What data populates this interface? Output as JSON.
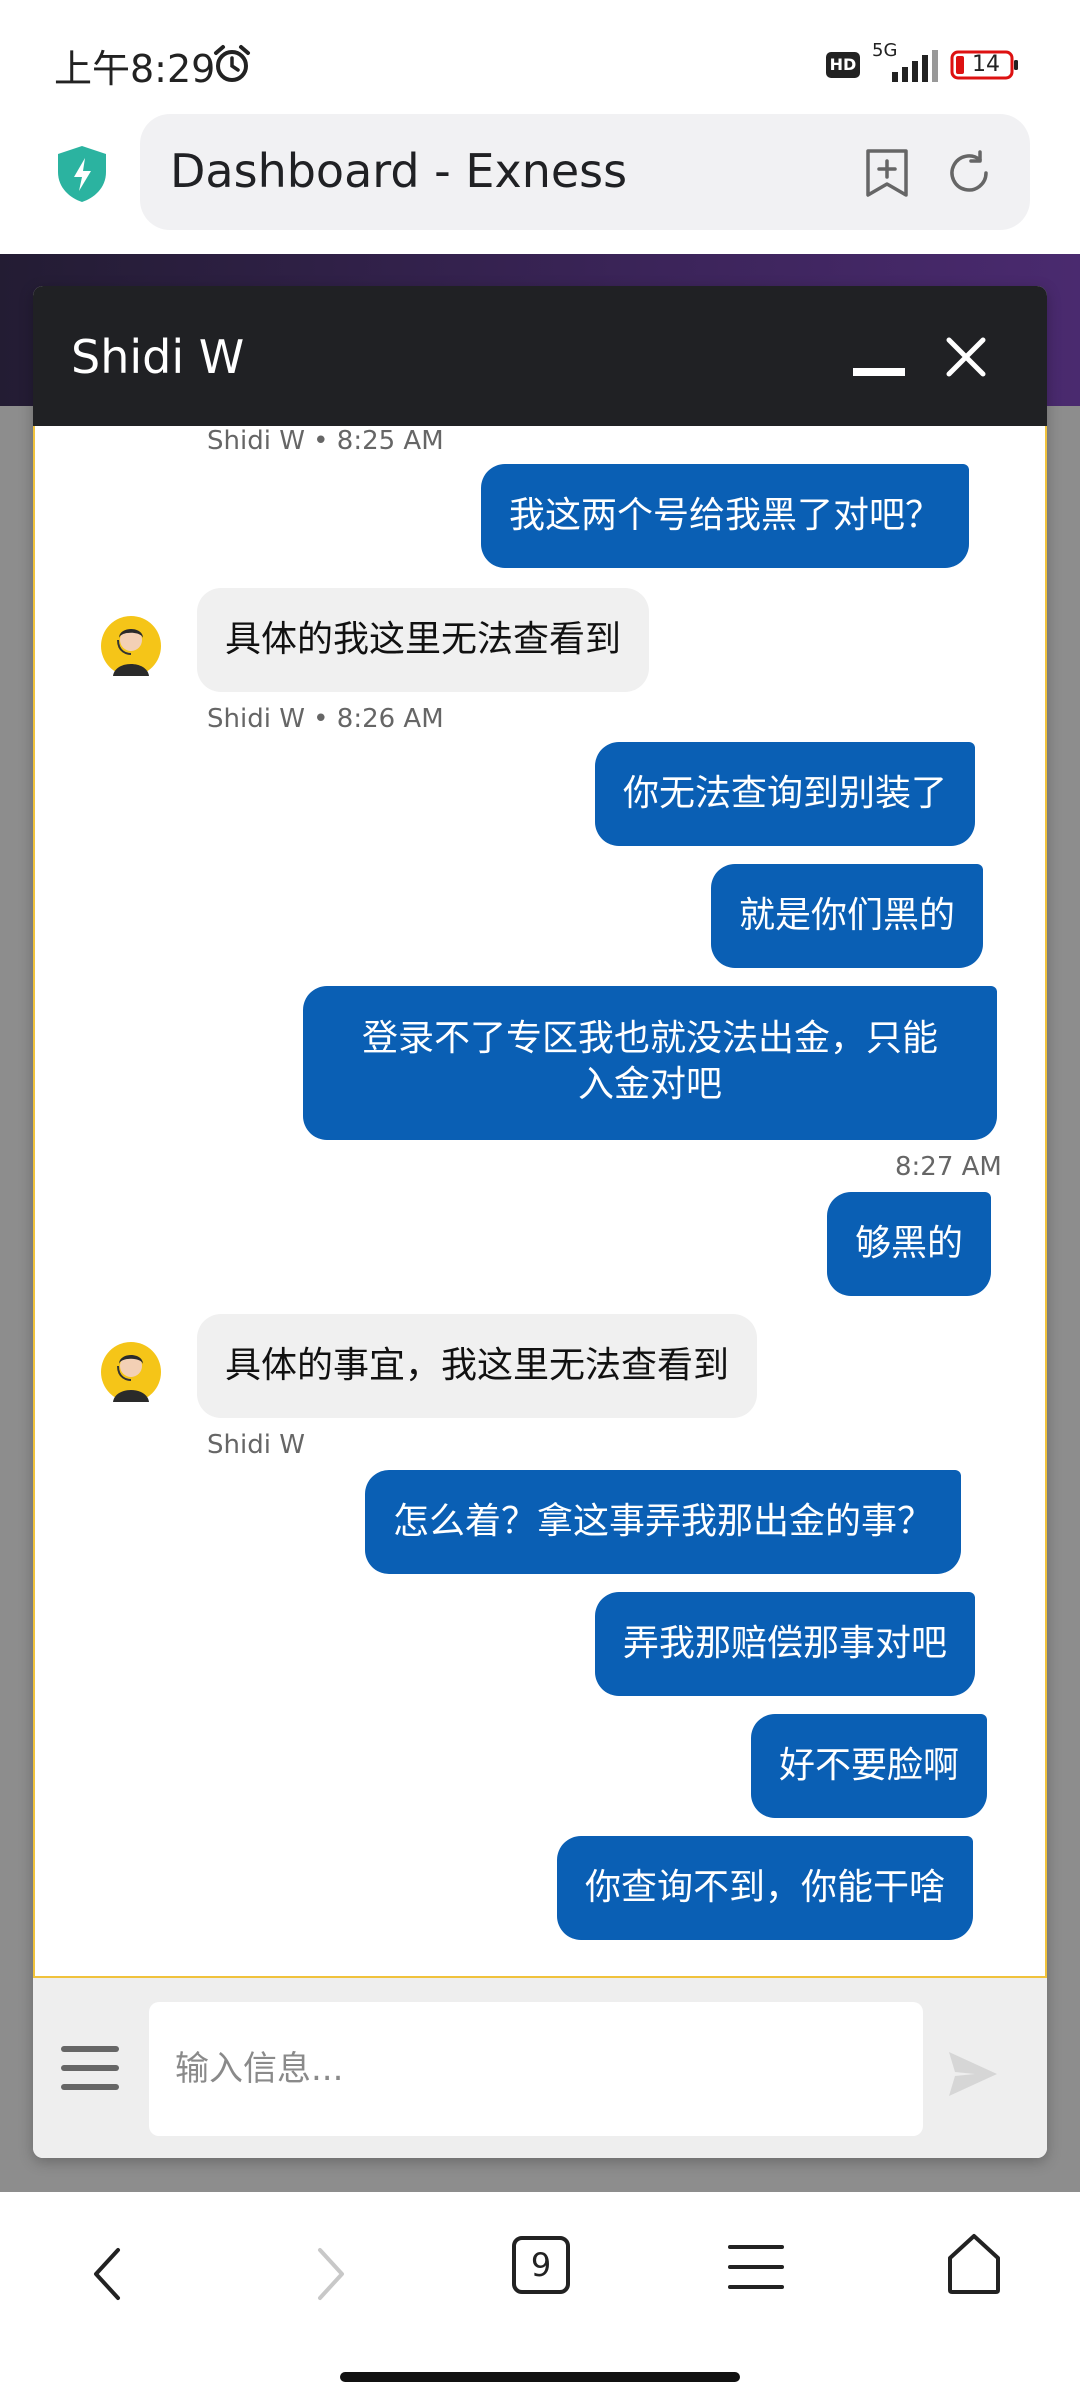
{
  "status_bar": {
    "time": "上午8:29",
    "network": "5G",
    "hd": "HD",
    "battery": "14"
  },
  "browser": {
    "page_title": "Dashboard - Exness"
  },
  "chat": {
    "title": "Shidi W",
    "input_placeholder": "输入信息...",
    "messages": [
      {
        "meta": "Shidi W • 8:25 AM"
      },
      {
        "text": "我这两个号给我黑了对吧？"
      },
      {
        "text": "具体的我这里无法查看到"
      },
      {
        "meta": "Shidi W • 8:26 AM"
      },
      {
        "text": "你无法查询到别装了"
      },
      {
        "text": "就是你们黑的"
      },
      {
        "line1": "登录不了专区我也就没法出金，只能",
        "line2": "入金对吧"
      },
      {
        "meta": "8:27 AM"
      },
      {
        "text": "够黑的"
      },
      {
        "text": "具体的事宜，我这里无法查看到"
      },
      {
        "meta": "Shidi W"
      },
      {
        "text": "怎么着？拿这事弄我那出金的事？"
      },
      {
        "text": "弄我那赔偿那事对吧"
      },
      {
        "text": "好不要脸啊"
      },
      {
        "text": "你查询不到，你能干啥"
      }
    ]
  },
  "bottom_nav": {
    "tab_count": "9"
  },
  "colors": {
    "outgoing_bubble": "#0a5fb4",
    "incoming_bubble": "#f0f0f0",
    "chat_header": "#202124",
    "widget_border": "#f0c23c",
    "browser_shield": "#2bb3a0"
  }
}
